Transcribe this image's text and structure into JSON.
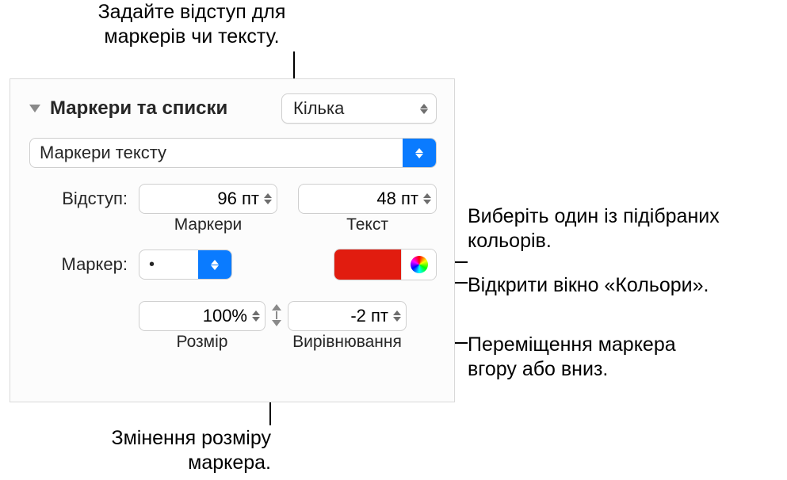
{
  "callouts": {
    "top": "Задайте відступ для маркерів чи тексту.",
    "pick_color": "Виберіть один із підібраних кольорів.",
    "open_colors": "Відкрити вікно «Кольори».",
    "move_bullet": "Переміщення маркера вгору або вниз.",
    "resize_bullet": "Змінення розміру маркера."
  },
  "panel": {
    "section_title": "Маркери та списки",
    "style_popup": "Кілька",
    "type_popup": "Маркери тексту",
    "indent_label": "Відступ:",
    "indent_bullets": "96 пт",
    "indent_text": "48 пт",
    "indent_bullets_sub": "Маркери",
    "indent_text_sub": "Текст",
    "bullet_label": "Маркер:",
    "bullet_symbol": "•",
    "bullet_color": "#e11c0f",
    "size_value": "100%",
    "size_label": "Розмір",
    "align_value": "-2 пт",
    "align_label": "Вирівнювання"
  }
}
